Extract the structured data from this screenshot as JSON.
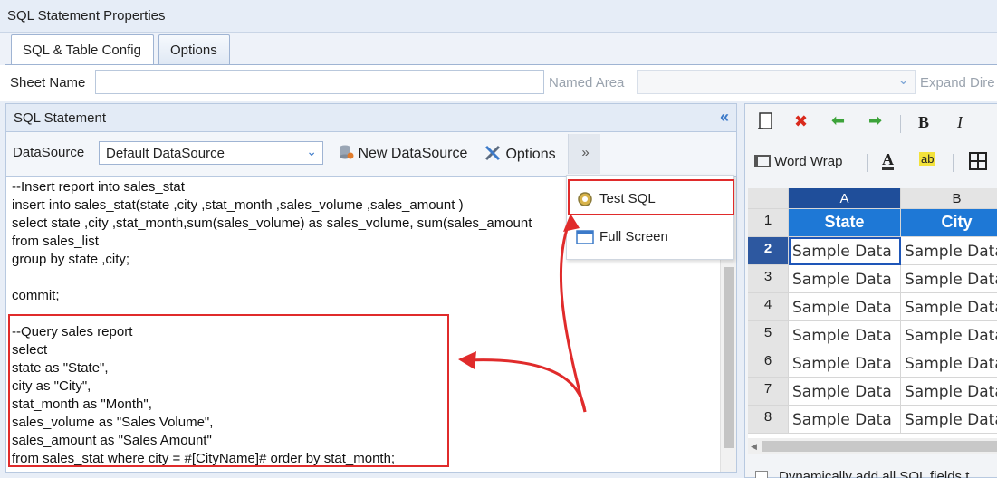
{
  "window": {
    "title": "SQL Statement Properties"
  },
  "tabs": [
    {
      "label": "SQL & Table Config",
      "active": true
    },
    {
      "label": "Options",
      "active": false
    }
  ],
  "sheet": {
    "sheet_name_label": "Sheet Name",
    "sheet_name_value": "",
    "named_area_label": "Named Area",
    "named_area_value": "",
    "expand_label": "Expand Dire"
  },
  "sql_panel": {
    "title": "SQL Statement",
    "datasource_label": "DataSource",
    "datasource_value": "Default DataSource",
    "new_datasource_label": "New DataSource",
    "options_label": "Options",
    "more_label": "»",
    "code_lines": [
      "--Insert report into sales_stat",
      "insert into sales_stat(state ,city ,stat_month ,sales_volume ,sales_amount )",
      "select state ,city ,stat_month,sum(sales_volume) as sales_volume, sum(sales_amount",
      "from sales_list",
      "group by state ,city;",
      "",
      "commit;",
      "",
      "--Query sales report",
      "select",
      "state as \"State\",",
      "city as \"City\",",
      "stat_month as \"Month\",",
      "sales_volume as \"Sales Volume\",",
      "sales_amount as \"Sales Amount\"",
      "from sales_stat where city = #[CityName]# order by stat_month;"
    ]
  },
  "menu": {
    "test_sql": "Test SQL",
    "full_screen": "Full Screen"
  },
  "toolbar_right": {
    "word_wrap": "Word Wrap",
    "bold": "B",
    "italic": "I"
  },
  "sheet_grid": {
    "columns": [
      "A",
      "B"
    ],
    "rows": [
      "1",
      "2",
      "3",
      "4",
      "5",
      "6",
      "7",
      "8"
    ],
    "header_cells": [
      "State",
      "City"
    ],
    "data_cell": "Sample Data"
  },
  "footer": {
    "checkbox_label": "Dynamically add all SQL fields t"
  },
  "colors": {
    "accent": "#1e78d6",
    "highlight_red": "#e02b2b",
    "selected_header": "#1f4e9a"
  }
}
